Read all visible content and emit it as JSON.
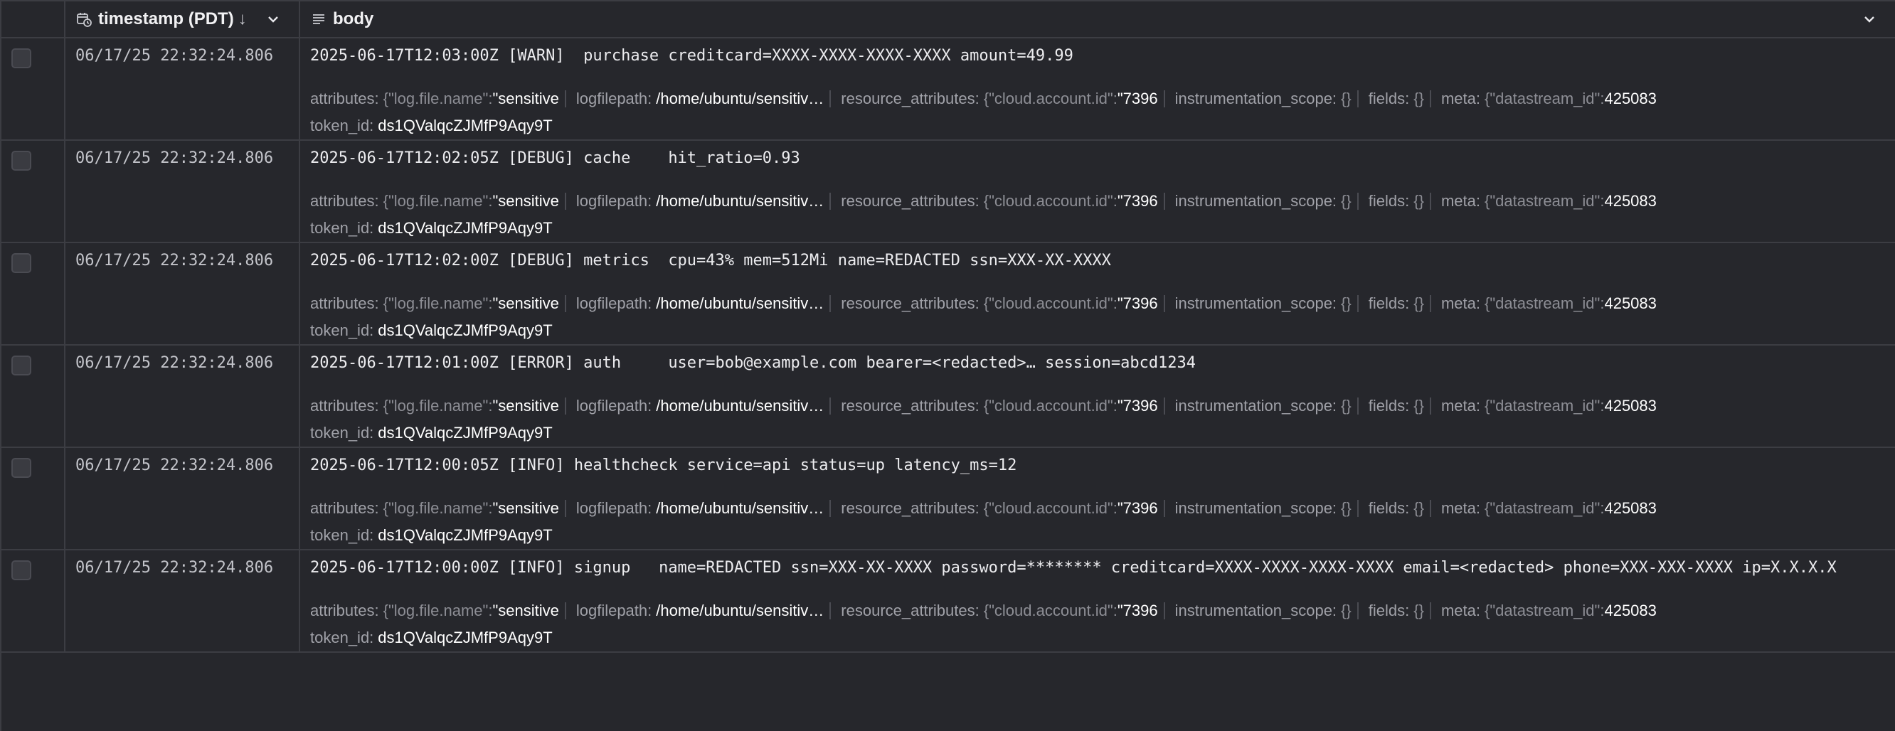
{
  "header": {
    "timestamp_label": "timestamp (PDT)",
    "sort_arrow": "↓",
    "body_label": "body",
    "icons": {
      "timestamp": "calendar-clock-icon",
      "body": "text-lines-icon",
      "chevron": "chevron-down-icon"
    }
  },
  "attr_keys": {
    "attributes": "attributes:",
    "logfilepath": "logfilepath:",
    "resource_attributes": "resource_attributes:",
    "instrumentation_scope": "instrumentation_scope:",
    "fields": "fields:",
    "meta": "meta:",
    "token_id": "token_id:"
  },
  "attr_values": {
    "attributes_open": "{\"log.file.name\":",
    "attributes_val": "\"sensitive",
    "logfilepath": "/home/ubuntu/sensitiv…",
    "resource_open": "{\"cloud.account.id\":",
    "resource_val": "\"7396",
    "instrumentation_scope": "{}",
    "fields": "{}",
    "meta_open": "{\"datastream_id\":",
    "meta_val": "425083",
    "token_id": "ds1QValqcZJMfP9Aqy9T"
  },
  "rows": [
    {
      "timestamp": "06/17/25 22:32:24.806",
      "message": "2025-06-17T12:03:00Z [WARN]  purchase creditcard=XXXX-XXXX-XXXX-XXXX amount=49.99"
    },
    {
      "timestamp": "06/17/25 22:32:24.806",
      "message": "2025-06-17T12:02:05Z [DEBUG] cache    hit_ratio=0.93"
    },
    {
      "timestamp": "06/17/25 22:32:24.806",
      "message": "2025-06-17T12:02:00Z [DEBUG] metrics  cpu=43% mem=512Mi name=REDACTED ssn=XXX-XX-XXXX"
    },
    {
      "timestamp": "06/17/25 22:32:24.806",
      "message": "2025-06-17T12:01:00Z [ERROR] auth     user=bob@example.com bearer=<redacted>… session=abcd1234"
    },
    {
      "timestamp": "06/17/25 22:32:24.806",
      "message": "2025-06-17T12:00:05Z [INFO] healthcheck service=api status=up latency_ms=12"
    },
    {
      "timestamp": "06/17/25 22:32:24.806",
      "message": "2025-06-17T12:00:00Z [INFO] signup   name=REDACTED ssn=XXX-XX-XXXX password=******** creditcard=XXXX-XXXX-XXXX-XXXX email=<redacted> phone=XXX-XXX-XXXX ip=X.X.X.X"
    }
  ]
}
